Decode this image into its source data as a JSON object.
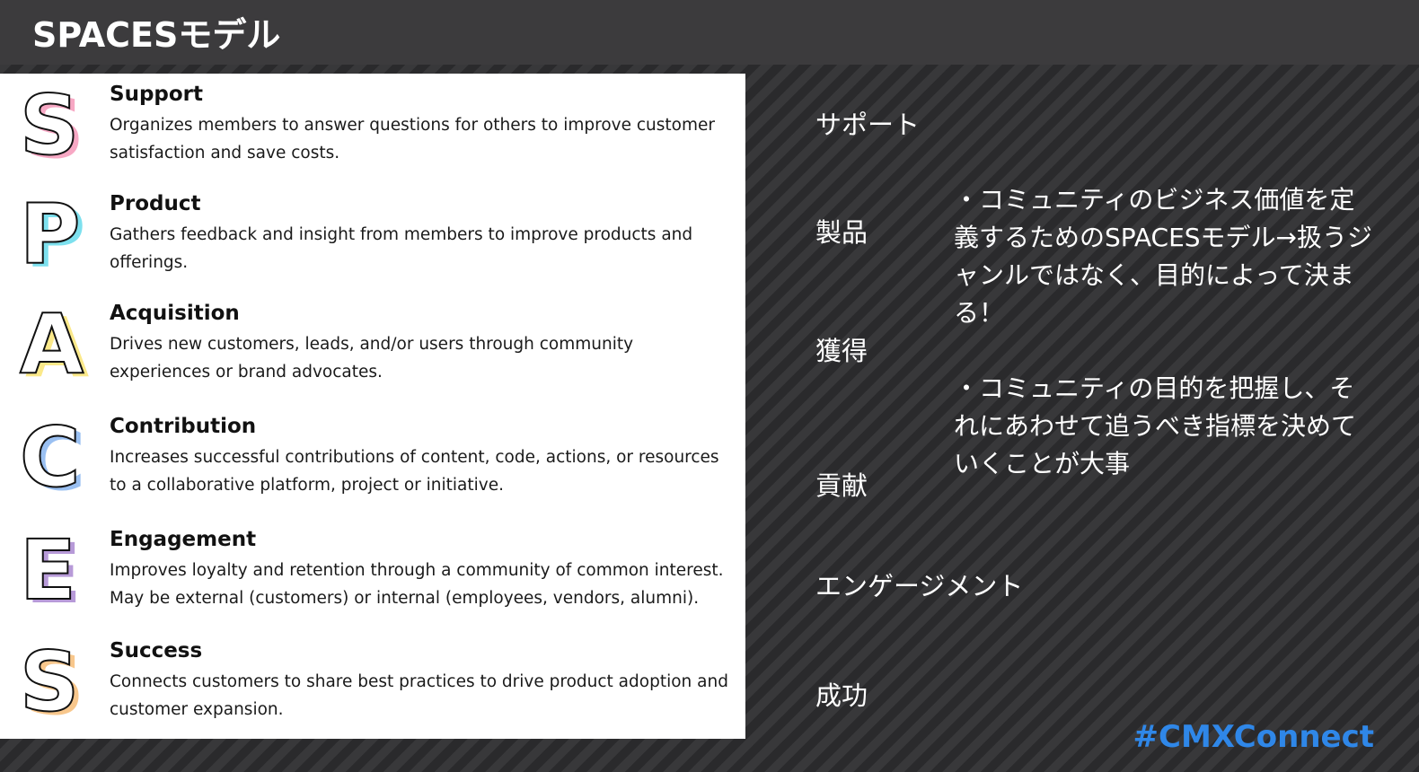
{
  "title": "SPACESモデル",
  "items": [
    {
      "letter": "S",
      "heading": "Support",
      "text": "Organizes members to answer questions for others to improve customer satisfaction and save costs.",
      "color": "#f7a8c4"
    },
    {
      "letter": "P",
      "heading": "Product",
      "text": "Gathers feedback and insight from members to improve products and offerings.",
      "color": "#7de0ee"
    },
    {
      "letter": "A",
      "heading": "Acquisition",
      "text": "Drives new customers, leads, and/or users through community experiences or brand advocates.",
      "color": "#fbe98a"
    },
    {
      "letter": "C",
      "heading": "Contribution",
      "text": "Increases successful contributions of content, code, actions, or resources to a collaborative platform, project or initiative.",
      "color": "#9ac0f2"
    },
    {
      "letter": "E",
      "heading": "Engagement",
      "text": "Improves loyalty and retention through a community of common interest. May be external (customers) or internal (employees, vendors, alumni).",
      "color": "#b79ad8"
    },
    {
      "letter": "S",
      "heading": "Success",
      "text": "Connects customers to share best practices to drive product adoption and customer expansion.",
      "color": "#f8c78c"
    }
  ],
  "jp_labels": [
    "サポート",
    "製品",
    "獲得",
    "貢献",
    "エンゲージメント",
    "成功"
  ],
  "notes": [
    "・コミュニティのビジネス価値を定義するためのSPACESモデル→扱うジャンルではなく、目的によって決まる！",
    "・コミュニティの目的を把握し、それにあわせて追うべき指標を決めていくことが大事"
  ],
  "hashtag": "#CMXConnect"
}
